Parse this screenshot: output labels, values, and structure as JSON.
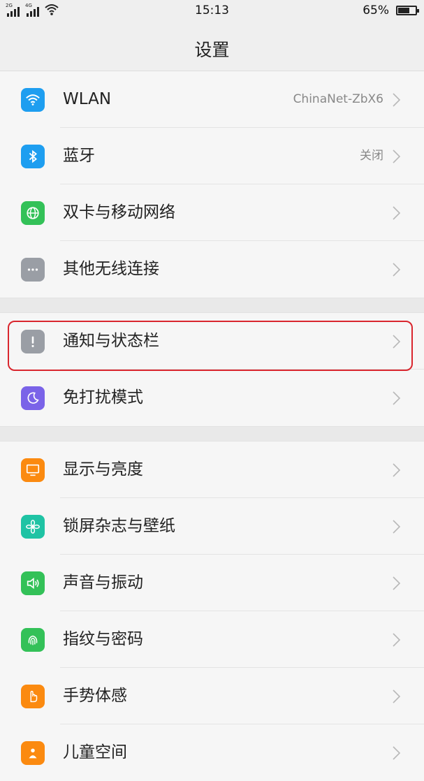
{
  "status_bar": {
    "sim1_tag": "2G",
    "sim2_tag": "4G",
    "time": "15:13",
    "battery_percent": "65%",
    "battery_level": 0.65
  },
  "header": {
    "title": "设置"
  },
  "groups": [
    {
      "items": [
        {
          "label": "WLAN",
          "value": "ChinaNet-ZbX6",
          "icon": "wifi-icon",
          "color": "#1e9ef0"
        },
        {
          "label": "蓝牙",
          "value": "关闭",
          "icon": "bluetooth-icon",
          "color": "#1e9ef0"
        },
        {
          "label": "双卡与移动网络",
          "value": "",
          "icon": "globe-icon",
          "color": "#33c158"
        },
        {
          "label": "其他无线连接",
          "value": "",
          "icon": "more-dots-icon",
          "color": "#9a9ea5"
        }
      ]
    },
    {
      "items": [
        {
          "label": "通知与状态栏",
          "value": "",
          "icon": "exclamation-icon",
          "color": "#9a9ea5",
          "highlighted": true
        },
        {
          "label": "免打扰模式",
          "value": "",
          "icon": "moon-icon",
          "color": "#7a63e8"
        }
      ]
    },
    {
      "items": [
        {
          "label": "显示与亮度",
          "value": "",
          "icon": "display-icon",
          "color": "#fb8a10"
        },
        {
          "label": "锁屏杂志与壁纸",
          "value": "",
          "icon": "flower-icon",
          "color": "#1fc3a4"
        },
        {
          "label": "声音与振动",
          "value": "",
          "icon": "speaker-icon",
          "color": "#33c158"
        },
        {
          "label": "指纹与密码",
          "value": "",
          "icon": "fingerprint-icon",
          "color": "#33c158"
        },
        {
          "label": "手势体感",
          "value": "",
          "icon": "hand-icon",
          "color": "#fb8a10"
        },
        {
          "label": "儿童空间",
          "value": "",
          "icon": "child-icon",
          "color": "#fb8a10"
        }
      ]
    }
  ],
  "colors": {
    "highlight_border": "#d9262e",
    "chevron": "#b8b8b8"
  }
}
